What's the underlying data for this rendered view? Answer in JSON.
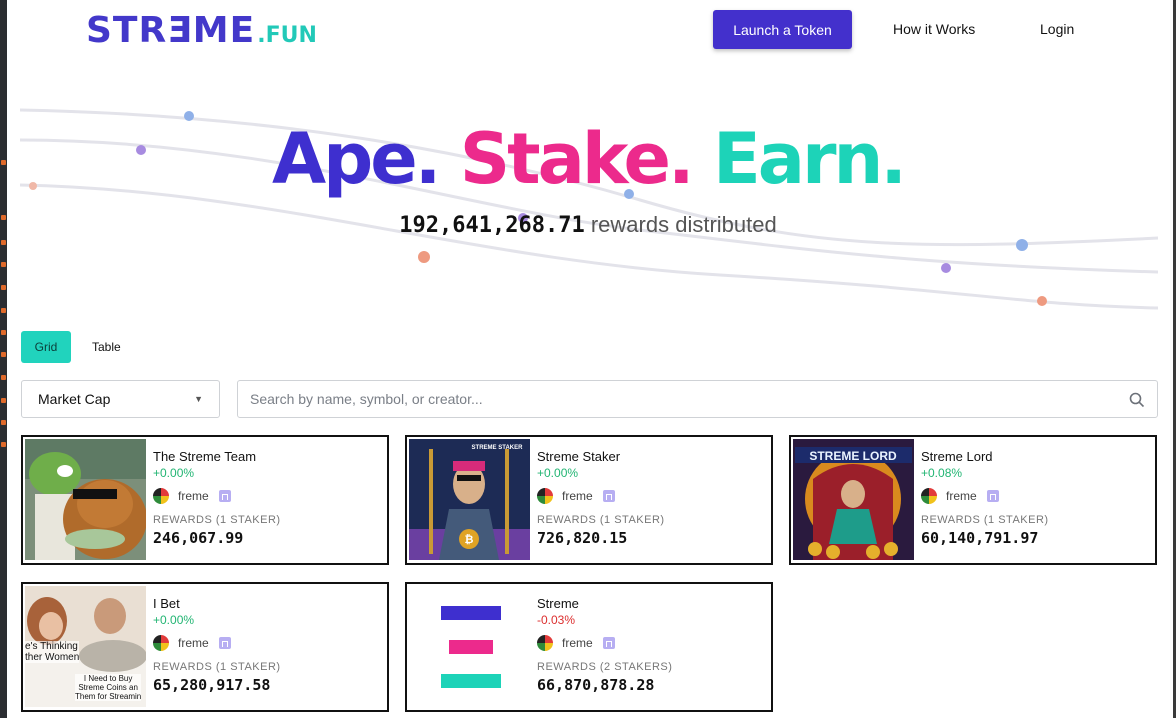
{
  "header": {
    "logo_main": "STRƎME",
    "logo_suffix": ".FUN",
    "launch_label": "Launch a Token",
    "nav": [
      "How it Works",
      "Login"
    ]
  },
  "hero": {
    "tag_ape": "Ape.",
    "tag_stake": "Stake.",
    "tag_earn": "Earn.",
    "rewards_value": "192,641,268.71",
    "rewards_text": "rewards distributed"
  },
  "view_toggle": {
    "grid": "Grid",
    "table": "Table"
  },
  "filters": {
    "sort_selected": "Market Cap",
    "search_placeholder": "Search by name, symbol, or creator..."
  },
  "tokens": [
    {
      "name": "The Streme Team",
      "change": "+0.00%",
      "creator": "freme",
      "rewards_label": "REWARDS (1 STAKER)",
      "rewards": "246,067.99",
      "image": "pepe-bear-image"
    },
    {
      "name": "Streme Staker",
      "change": "+0.00%",
      "creator": "freme",
      "rewards_label": "REWARDS (1 STAKER)",
      "rewards": "726,820.15",
      "image": "trident-staker-image"
    },
    {
      "name": "Streme Lord",
      "change": "+0.08%",
      "creator": "freme",
      "rewards_label": "REWARDS (1 STAKER)",
      "rewards": "60,140,791.97",
      "image": "throne-lord-image"
    },
    {
      "name": "I Bet",
      "change": "+0.00%",
      "creator": "freme",
      "rewards_label": "REWARDS (1 STAKER)",
      "rewards": "65,280,917.58",
      "image": "bed-meme-image",
      "meme_text_1": "e's Thinking\nther Women",
      "meme_text_2": "I Need to Buy\nStreme Coins an\nThem for Streamin"
    },
    {
      "name": "Streme",
      "change": "-0.03%",
      "creator": "freme",
      "rewards_label": "REWARDS (2 STAKERS)",
      "rewards": "66,870,878.28",
      "image": "streme-logo-bars"
    }
  ],
  "colors": {
    "brand": "#4330cc",
    "accent_teal": "#21d3bd",
    "pink": "#ec2a8c",
    "positive": "#22b573",
    "negative": "#dc2f2f"
  },
  "image_text": {
    "streme_lord": "STREME LORD",
    "streme_staker": "STREME STAKER"
  }
}
